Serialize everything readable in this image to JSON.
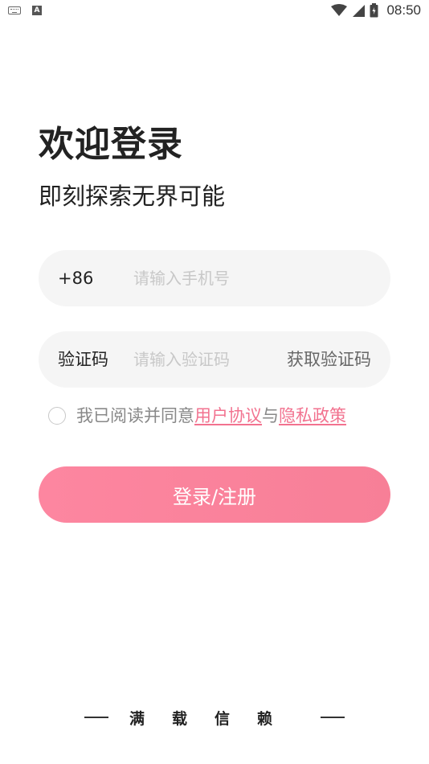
{
  "status_bar": {
    "time": "08:50",
    "left_icons": [
      "keyboard-icon",
      "text-a-icon"
    ],
    "right_icons": [
      "wifi-icon",
      "signal-icon",
      "battery-icon"
    ]
  },
  "header": {
    "title": "欢迎登录",
    "subtitle": "即刻探索无界可能"
  },
  "phone_field": {
    "prefix": "+86",
    "placeholder": "请输入手机号",
    "value": ""
  },
  "code_field": {
    "label": "验证码",
    "placeholder": "请输入验证码",
    "value": "",
    "get_code_label": "获取验证码"
  },
  "agreement": {
    "checked": false,
    "text_before": "我已阅读并同意",
    "user_agreement": "用户协议",
    "connector": "与",
    "privacy_policy": "隐私政策"
  },
  "login_button": {
    "label": "登录/注册"
  },
  "footer": {
    "slogan": "满载信赖"
  },
  "colors": {
    "accent": "#f77f97",
    "link": "#f2728f",
    "input_bg": "#f5f5f5",
    "placeholder": "#c8c8c8"
  }
}
